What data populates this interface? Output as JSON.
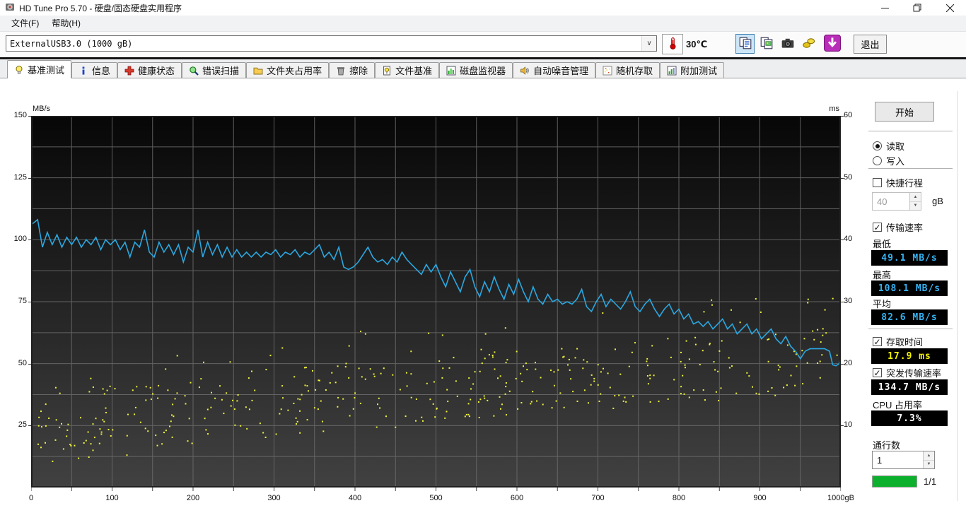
{
  "window": {
    "title": "HD Tune Pro 5.70 - 硬盘/固态硬盘实用程序"
  },
  "menu": {
    "items": [
      "文件(F)",
      "帮助(H)"
    ]
  },
  "toolbar": {
    "drive_select_value": "ExternalUSB3.0 (1000 gB)",
    "temperature": "30℃",
    "icon_buttons": [
      {
        "name": "copy-text-button",
        "icon": "copy-text-icon",
        "active": true
      },
      {
        "name": "copy-image-button",
        "icon": "copy-image-icon",
        "active": false
      },
      {
        "name": "screenshot-button",
        "icon": "camera-icon",
        "active": false
      },
      {
        "name": "export-button",
        "icon": "gold-export-icon",
        "active": false
      },
      {
        "name": "save-results-button",
        "icon": "down-arrow-icon",
        "active": false
      }
    ],
    "exit_label": "退出"
  },
  "tabs": [
    {
      "label": "基准测试",
      "icon": "bulb-icon",
      "active": true
    },
    {
      "label": "信息",
      "icon": "info-icon",
      "active": false
    },
    {
      "label": "健康状态",
      "icon": "health-cross-icon",
      "active": false
    },
    {
      "label": "错误扫描",
      "icon": "scan-magnifier-icon",
      "active": false
    },
    {
      "label": "文件夹占用率",
      "icon": "folder-icon",
      "active": false
    },
    {
      "label": "擦除",
      "icon": "trash-icon",
      "active": false
    },
    {
      "label": "文件基准",
      "icon": "file-benchmark-icon",
      "active": false
    },
    {
      "label": "磁盘监视器",
      "icon": "disk-monitor-icon",
      "active": false
    },
    {
      "label": "自动噪音管理",
      "icon": "speaker-icon",
      "active": false
    },
    {
      "label": "随机存取",
      "icon": "random-access-icon",
      "active": false
    },
    {
      "label": "附加测试",
      "icon": "extra-tests-icon",
      "active": false
    }
  ],
  "chart_data": {
    "type": "line",
    "x_axis": {
      "min": 0,
      "max": 1000,
      "unit": "gB",
      "grid_step": 50,
      "tick_labels": [
        "0",
        "100",
        "200",
        "300",
        "400",
        "500",
        "600",
        "700",
        "800",
        "900",
        "1000gB"
      ]
    },
    "y_left": {
      "unit": "MB/s",
      "min": 0,
      "max": 150,
      "grid_step": 12.5,
      "tick_labels": [
        "150",
        "125",
        "100",
        "75",
        "50",
        "25"
      ],
      "tick_values": [
        150,
        125,
        100,
        75,
        50,
        25
      ]
    },
    "y_right": {
      "unit": "ms",
      "min": 0,
      "max": 60,
      "tick_labels": [
        "60",
        "50",
        "40",
        "30",
        "20",
        "10"
      ],
      "tick_values": [
        60,
        50,
        40,
        30,
        20,
        10
      ]
    },
    "plot_style": {
      "bg_top": "#070707",
      "bg_bottom": "#414141",
      "grid_color": "#6d6d6d",
      "border_color": "#1f1f1f"
    },
    "series": [
      {
        "name": "transfer-rate",
        "type": "line",
        "axis": "left",
        "unit": "MB/s",
        "color": "#2aa7e0",
        "points": [
          [
            0,
            106
          ],
          [
            8,
            108.1
          ],
          [
            14,
            97
          ],
          [
            20,
            103
          ],
          [
            26,
            98
          ],
          [
            32,
            102
          ],
          [
            38,
            97
          ],
          [
            44,
            101
          ],
          [
            50,
            98
          ],
          [
            56,
            101
          ],
          [
            62,
            97
          ],
          [
            68,
            100
          ],
          [
            74,
            98
          ],
          [
            80,
            101
          ],
          [
            86,
            96
          ],
          [
            92,
            100
          ],
          [
            98,
            98
          ],
          [
            104,
            100
          ],
          [
            110,
            96
          ],
          [
            116,
            99
          ],
          [
            122,
            93
          ],
          [
            128,
            99
          ],
          [
            134,
            97
          ],
          [
            140,
            104
          ],
          [
            146,
            95
          ],
          [
            152,
            93
          ],
          [
            158,
            99
          ],
          [
            164,
            95
          ],
          [
            170,
            98
          ],
          [
            176,
            94
          ],
          [
            182,
            98
          ],
          [
            188,
            91
          ],
          [
            194,
            97
          ],
          [
            200,
            95
          ],
          [
            206,
            104
          ],
          [
            212,
            93
          ],
          [
            218,
            99
          ],
          [
            224,
            94
          ],
          [
            230,
            98
          ],
          [
            236,
            93
          ],
          [
            242,
            97
          ],
          [
            248,
            93
          ],
          [
            254,
            96
          ],
          [
            260,
            93
          ],
          [
            266,
            95
          ],
          [
            272,
            93
          ],
          [
            278,
            95
          ],
          [
            284,
            93
          ],
          [
            290,
            95
          ],
          [
            296,
            94
          ],
          [
            302,
            96
          ],
          [
            308,
            93
          ],
          [
            314,
            95
          ],
          [
            320,
            94
          ],
          [
            326,
            96
          ],
          [
            332,
            93
          ],
          [
            338,
            95
          ],
          [
            344,
            94
          ],
          [
            350,
            96
          ],
          [
            356,
            98
          ],
          [
            362,
            93
          ],
          [
            368,
            95
          ],
          [
            374,
            92
          ],
          [
            380,
            97
          ],
          [
            386,
            89
          ],
          [
            392,
            88
          ],
          [
            398,
            89
          ],
          [
            404,
            91
          ],
          [
            410,
            94
          ],
          [
            416,
            97
          ],
          [
            422,
            93
          ],
          [
            428,
            91
          ],
          [
            434,
            92
          ],
          [
            440,
            90
          ],
          [
            446,
            93
          ],
          [
            452,
            91
          ],
          [
            458,
            95
          ],
          [
            464,
            92
          ],
          [
            470,
            90
          ],
          [
            476,
            88
          ],
          [
            482,
            86
          ],
          [
            488,
            90
          ],
          [
            494,
            87
          ],
          [
            500,
            90
          ],
          [
            506,
            85
          ],
          [
            512,
            81
          ],
          [
            518,
            87
          ],
          [
            524,
            83
          ],
          [
            530,
            79
          ],
          [
            536,
            85
          ],
          [
            542,
            88
          ],
          [
            548,
            81
          ],
          [
            554,
            77
          ],
          [
            560,
            83
          ],
          [
            566,
            79
          ],
          [
            572,
            85
          ],
          [
            578,
            80
          ],
          [
            584,
            76
          ],
          [
            590,
            82
          ],
          [
            596,
            78
          ],
          [
            602,
            84
          ],
          [
            608,
            79
          ],
          [
            614,
            75
          ],
          [
            620,
            81
          ],
          [
            626,
            76
          ],
          [
            632,
            74
          ],
          [
            638,
            78
          ],
          [
            644,
            75
          ],
          [
            650,
            76
          ],
          [
            656,
            74
          ],
          [
            662,
            75
          ],
          [
            668,
            74
          ],
          [
            674,
            76
          ],
          [
            680,
            80
          ],
          [
            686,
            73
          ],
          [
            692,
            71
          ],
          [
            698,
            75
          ],
          [
            704,
            78
          ],
          [
            710,
            73
          ],
          [
            716,
            76
          ],
          [
            722,
            74
          ],
          [
            728,
            72
          ],
          [
            734,
            75
          ],
          [
            740,
            79
          ],
          [
            746,
            73
          ],
          [
            752,
            71
          ],
          [
            758,
            74
          ],
          [
            764,
            76
          ],
          [
            770,
            72
          ],
          [
            776,
            69
          ],
          [
            782,
            72
          ],
          [
            788,
            74
          ],
          [
            794,
            70
          ],
          [
            800,
            72
          ],
          [
            806,
            68
          ],
          [
            812,
            70
          ],
          [
            818,
            66
          ],
          [
            824,
            67
          ],
          [
            830,
            65
          ],
          [
            836,
            67
          ],
          [
            842,
            64
          ],
          [
            848,
            66
          ],
          [
            854,
            68
          ],
          [
            860,
            64
          ],
          [
            866,
            66
          ],
          [
            872,
            62
          ],
          [
            878,
            64
          ],
          [
            884,
            66
          ],
          [
            890,
            62
          ],
          [
            896,
            64
          ],
          [
            902,
            60
          ],
          [
            908,
            62
          ],
          [
            914,
            64
          ],
          [
            920,
            60
          ],
          [
            926,
            58
          ],
          [
            932,
            61
          ],
          [
            938,
            57
          ],
          [
            944,
            55
          ],
          [
            950,
            52
          ],
          [
            956,
            55
          ],
          [
            962,
            56
          ],
          [
            968,
            56
          ],
          [
            974,
            56
          ],
          [
            980,
            56
          ],
          [
            986,
            55
          ],
          [
            990,
            49.5
          ],
          [
            994,
            49.1
          ],
          [
            998,
            50
          ],
          [
            1000,
            53
          ]
        ]
      },
      {
        "name": "access-time",
        "type": "scatter",
        "axis": "right",
        "unit": "ms",
        "color": "#f0f23a",
        "point_count": 430,
        "seed": 987653,
        "band": {
          "center_at_x0_ms": 10.5,
          "center_at_x1000_ms": 21,
          "spread_ms": 5.5,
          "low_cluster_left": true,
          "outlier_rate": 0.07,
          "min_ms": 3,
          "max_ms": 30.5
        }
      }
    ]
  },
  "panel": {
    "start_button": "开始",
    "mode": {
      "read_label": "读取",
      "write_label": "写入",
      "selected": "read"
    },
    "short_stroke": {
      "label": "快捷行程",
      "checked": false,
      "value": "40",
      "unit": "gB",
      "enabled": false
    },
    "transfer_rate": {
      "label": "传输速率",
      "checked": true,
      "min_label": "最低",
      "min_value": "49.1 MB/s",
      "max_label": "最高",
      "max_value": "108.1 MB/s",
      "avg_label": "平均",
      "avg_value": "82.6 MB/s"
    },
    "access_time": {
      "label": "存取时间",
      "checked": true,
      "value": "17.9 ms"
    },
    "burst_rate": {
      "label": "突发传输速率",
      "checked": true,
      "value": "134.7 MB/s"
    },
    "cpu_usage": {
      "label": "CPU 占用率",
      "value": "7.3%"
    },
    "pass_count": {
      "label": "通行数",
      "value": "1"
    },
    "progress": {
      "label": "1/1",
      "fraction": 1,
      "color": "#0cb02c"
    }
  }
}
